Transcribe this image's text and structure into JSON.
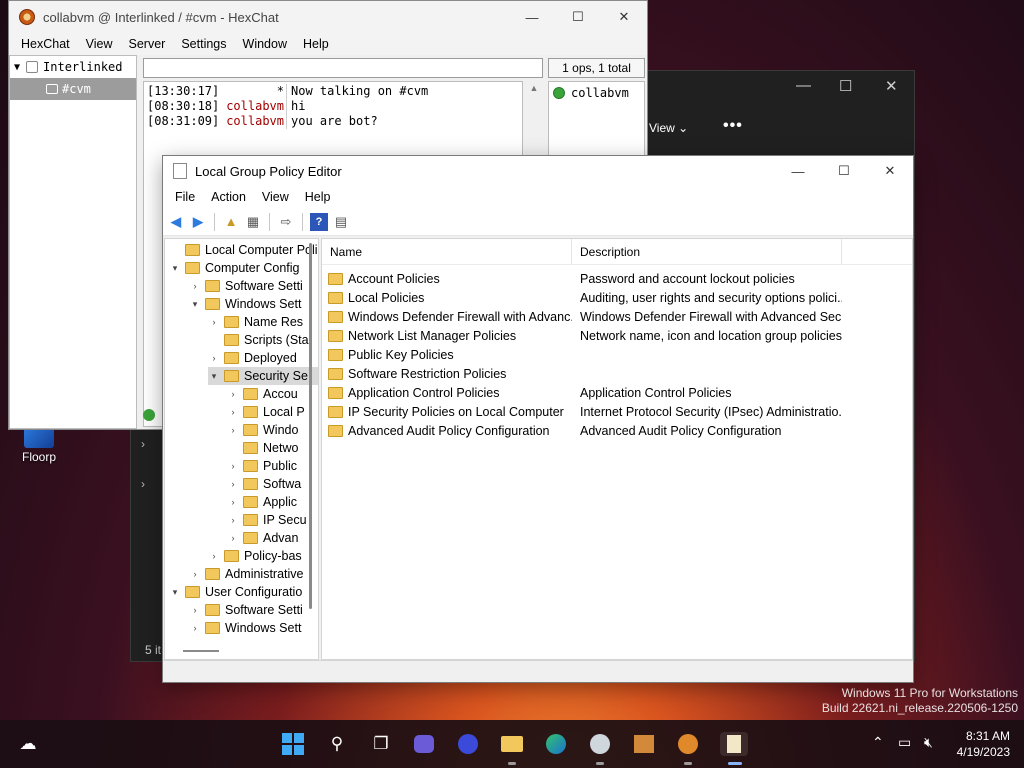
{
  "desktop": {
    "icon_label": "Floorp"
  },
  "explorer_bg": {
    "view_label": "View ⌄",
    "more_label": "•••",
    "item_count": "5 it"
  },
  "hexchat": {
    "title": "collabvm @ Interlinked / #cvm - HexChat",
    "menu": [
      "HexChat",
      "View",
      "Server",
      "Settings",
      "Window",
      "Help"
    ],
    "network": "Interlinked",
    "channel": "#cvm",
    "user_count": "1 ops, 1 total",
    "messages": [
      {
        "time": "[13:30:17]",
        "nick": "*",
        "text": "Now talking on #cvm",
        "system": true
      },
      {
        "time": "[08:30:18]",
        "nick": "collabvm",
        "text": "hi",
        "system": false
      },
      {
        "time": "[08:31:09]",
        "nick": "collabvm",
        "text": "you are bot?",
        "system": false
      }
    ],
    "users": [
      "collabvm"
    ]
  },
  "gpe": {
    "title": "Local Group Policy Editor",
    "menu": [
      "File",
      "Action",
      "View",
      "Help"
    ],
    "tree": [
      {
        "label": "Local Computer Polic",
        "chev": "",
        "level": 0
      },
      {
        "label": "Computer Config",
        "chev": "v",
        "level": 0
      },
      {
        "label": "Software Setti",
        "chev": ">",
        "level": 1
      },
      {
        "label": "Windows Sett",
        "chev": "v",
        "level": 1
      },
      {
        "label": "Name Res",
        "chev": ">",
        "level": 2
      },
      {
        "label": "Scripts (Sta",
        "chev": "",
        "level": 2
      },
      {
        "label": "Deployed",
        "chev": ">",
        "level": 2
      },
      {
        "label": "Security Se",
        "chev": "v",
        "level": 2,
        "selected": true
      },
      {
        "label": "Accou",
        "chev": ">",
        "level": 3
      },
      {
        "label": "Local P",
        "chev": ">",
        "level": 3
      },
      {
        "label": "Windo",
        "chev": ">",
        "level": 3
      },
      {
        "label": "Netwo",
        "chev": "",
        "level": 3
      },
      {
        "label": "Public",
        "chev": ">",
        "level": 3
      },
      {
        "label": "Softwa",
        "chev": ">",
        "level": 3
      },
      {
        "label": "Applic",
        "chev": ">",
        "level": 3
      },
      {
        "label": "IP Secu",
        "chev": ">",
        "level": 3
      },
      {
        "label": "Advan",
        "chev": ">",
        "level": 3
      },
      {
        "label": "Policy-bas",
        "chev": ">",
        "level": 2
      },
      {
        "label": "Administrative",
        "chev": ">",
        "level": 1
      },
      {
        "label": "User Configuratio",
        "chev": "v",
        "level": 0
      },
      {
        "label": "Software Setti",
        "chev": ">",
        "level": 1
      },
      {
        "label": "Windows Sett",
        "chev": ">",
        "level": 1
      }
    ],
    "columns": {
      "name": "Name",
      "description": "Description"
    },
    "rows": [
      {
        "name": "Account Policies",
        "desc": "Password and account lockout policies"
      },
      {
        "name": "Local Policies",
        "desc": "Auditing, user rights and security options polici..."
      },
      {
        "name": "Windows Defender Firewall with Advanc...",
        "desc": "Windows Defender Firewall with Advanced Sec..."
      },
      {
        "name": "Network List Manager Policies",
        "desc": "Network name, icon and location group policies."
      },
      {
        "name": "Public Key Policies",
        "desc": ""
      },
      {
        "name": "Software Restriction Policies",
        "desc": ""
      },
      {
        "name": "Application Control Policies",
        "desc": "Application Control Policies"
      },
      {
        "name": "IP Security Policies on Local Computer",
        "desc": "Internet Protocol Security (IPsec) Administratio..."
      },
      {
        "name": "Advanced Audit Policy Configuration",
        "desc": "Advanced Audit Policy Configuration"
      }
    ]
  },
  "watermark": {
    "line1": "Windows 11 Pro for Workstations",
    "line2": "Build 22621.ni_release.220506-1250"
  },
  "clock": {
    "time": "8:31 AM",
    "date": "4/19/2023"
  },
  "colors": {
    "accent": "#2c7be0",
    "folder": "#f2c75c",
    "nick": "#a20000",
    "online": "#3aa33a"
  }
}
